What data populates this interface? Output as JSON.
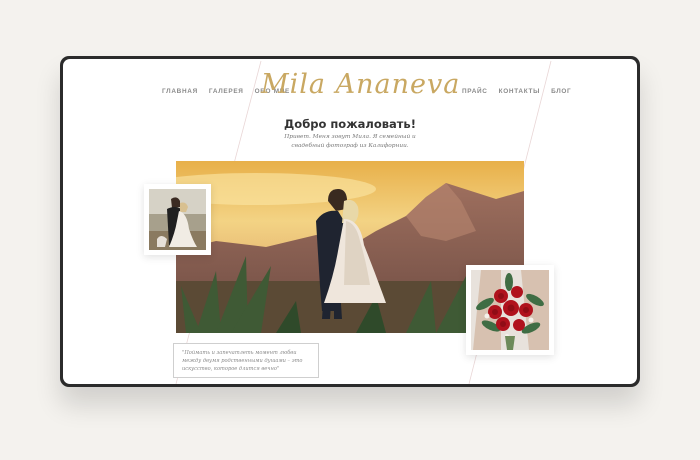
{
  "nav": {
    "left": [
      "ГЛАВНАЯ",
      "ГАЛЕРЕЯ",
      "ОБО МНЕ"
    ],
    "right": [
      "ПРАЙС",
      "КОНТАКТЫ",
      "БЛОГ"
    ]
  },
  "logo": "Mila Ananeva",
  "welcome": {
    "title": "Добро пожаловать!",
    "intro": "Привет. Меня зовут Мила. Я семейный и свадебный фотограф из Калифорнии."
  },
  "quote": "\"Поймать и запечатлеть момент любви между двумя родственными душами – это искусство, которое длится вечно\"",
  "colors": {
    "background": "#f4f2ee",
    "frame": "#2b2b2b",
    "accent_gold": "#c9a862",
    "nav_text": "#8a8a8a"
  }
}
